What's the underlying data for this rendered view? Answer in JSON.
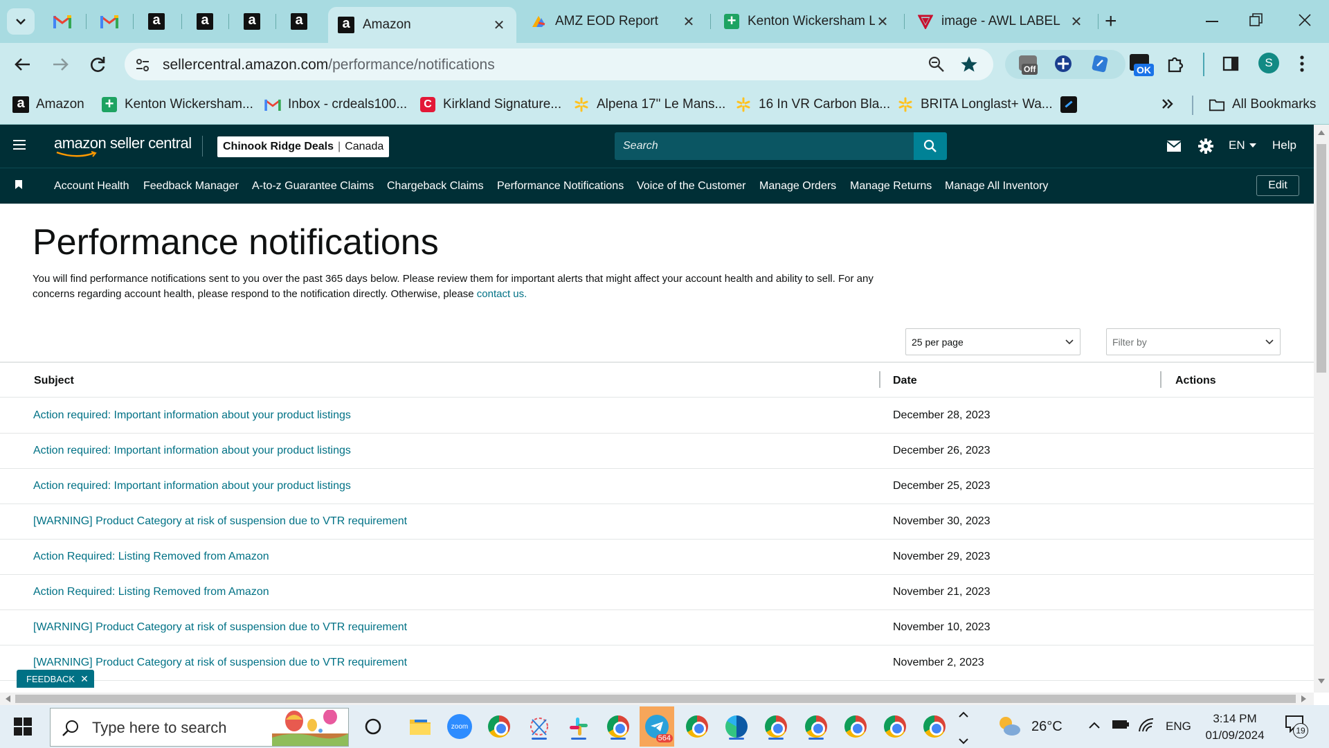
{
  "browser": {
    "tabs": [
      {
        "title": "Amazon",
        "active": true
      },
      {
        "title": "AMZ EOD Report",
        "active": false
      },
      {
        "title": "Kenton Wickersham L",
        "active": false
      },
      {
        "title": "image - AWL LABEL",
        "active": false
      }
    ],
    "url_domain": "sellercentral.amazon.com",
    "url_path": "/performance/notifications",
    "extension_badges": {
      "off": "Off",
      "ok": "OK"
    },
    "profile_initial": "S",
    "bookmarks": [
      {
        "label": "Amazon",
        "icon": "amazon-icon"
      },
      {
        "label": "Kenton Wickersham...",
        "icon": "sheets-icon"
      },
      {
        "label": "Inbox - crdeals100...",
        "icon": "gmail-icon"
      },
      {
        "label": "Kirkland Signature...",
        "icon": "costco-icon"
      },
      {
        "label": "Alpena 17\" Le Mans...",
        "icon": "walmart-icon"
      },
      {
        "label": "16 In VR Carbon Bla...",
        "icon": "walmart-icon"
      },
      {
        "label": "BRITA Longlast+ Wa...",
        "icon": "walmart-icon"
      }
    ],
    "all_bookmarks": "All Bookmarks"
  },
  "seller": {
    "logo_text": "amazon seller central",
    "store_name": "Chinook Ridge Deals",
    "marketplace": "Canada",
    "search_placeholder": "Search",
    "language": "EN",
    "help": "Help",
    "nav": [
      "Account Health",
      "Feedback Manager",
      "A-to-z Guarantee Claims",
      "Chargeback Claims",
      "Performance Notifications",
      "Voice of the Customer",
      "Manage Orders",
      "Manage Returns",
      "Manage All Inventory"
    ],
    "edit": "Edit"
  },
  "page": {
    "title": "Performance notifications",
    "description": "You will find performance notifications sent to you over the past 365 days below. Please review them for important alerts that might affect your account health and ability to sell. For any concerns regarding account health, please respond to the notification directly. Otherwise, please",
    "contact_link": "contact us.",
    "per_page": "25 per page",
    "filter_placeholder": "Filter by",
    "columns": {
      "subject": "Subject",
      "date": "Date",
      "actions": "Actions"
    },
    "rows": [
      {
        "subject": "Action required: Important information about your product listings",
        "date": "December 28, 2023"
      },
      {
        "subject": "Action required: Important information about your product listings",
        "date": "December 26, 2023"
      },
      {
        "subject": "Action required: Important information about your product listings",
        "date": "December 25, 2023"
      },
      {
        "subject": "[WARNING] Product Category at risk of suspension due to VTR requirement",
        "date": "November 30, 2023"
      },
      {
        "subject": "Action Required: Listing Removed from Amazon",
        "date": "November 29, 2023"
      },
      {
        "subject": "Action Required: Listing Removed from Amazon",
        "date": "November 21, 2023"
      },
      {
        "subject": "[WARNING] Product Category at risk of suspension due to VTR requirement",
        "date": "November 10, 2023"
      },
      {
        "subject": "[WARNING] Product Category at risk of suspension due to VTR requirement",
        "date": "November 2, 2023"
      }
    ],
    "feedback": "FEEDBACK"
  },
  "taskbar": {
    "search_placeholder": "Type here to search",
    "zoom_label": "zoom",
    "telegram_badge": "564",
    "temperature": "26°C",
    "language": "ENG",
    "time": "3:14 PM",
    "date": "01/09/2024",
    "notifications": "19"
  }
}
